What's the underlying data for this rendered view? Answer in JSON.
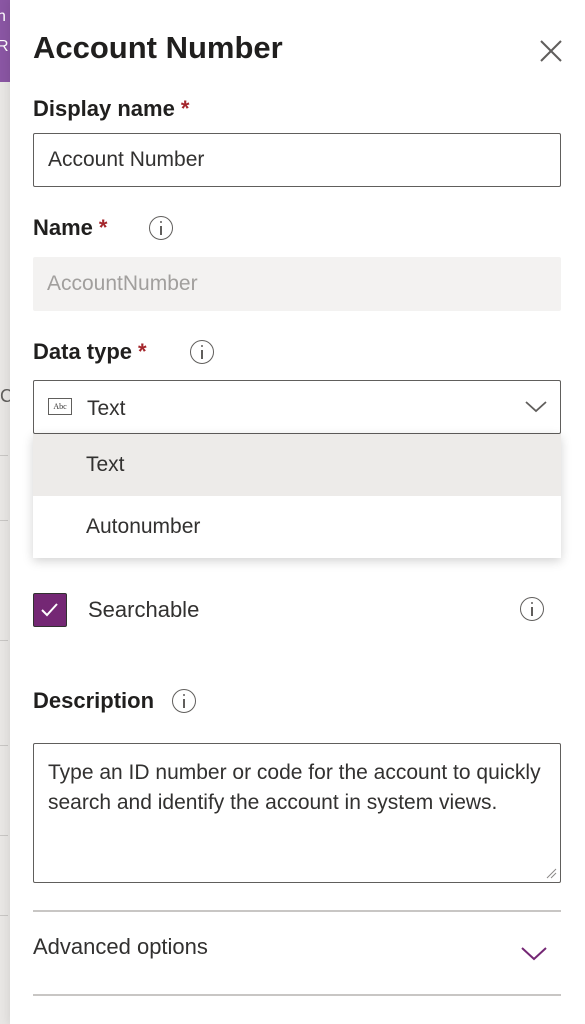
{
  "background": {
    "accent_color": "#8a56a3",
    "cut_off_text": [
      "n",
      "R"
    ],
    "cut_off_letter": "C"
  },
  "panel": {
    "title": "Account Number",
    "close_icon": "close-icon"
  },
  "display_name": {
    "label": "Display name",
    "required_mark": "*",
    "value": "Account Number"
  },
  "name": {
    "label": "Name",
    "required_mark": "*",
    "value": "AccountNumber",
    "info_icon": "info-icon"
  },
  "data_type": {
    "label": "Data type",
    "required_mark": "*",
    "icon_text": "Abc",
    "value": "Text",
    "options": [
      "Text",
      "Autonumber"
    ],
    "selected_option": "Text"
  },
  "searchable": {
    "label": "Searchable",
    "checked": true,
    "checkbox_color": "#742774"
  },
  "description": {
    "label": "Description",
    "value": "Type an ID number or code for the account to quickly search and identify the account in system views."
  },
  "advanced": {
    "label": "Advanced options",
    "chevron_color": "#742774"
  },
  "colors": {
    "required": "#a4262c",
    "disabled_bg": "#f3f2f1",
    "selected_option_bg": "#edebe9"
  }
}
